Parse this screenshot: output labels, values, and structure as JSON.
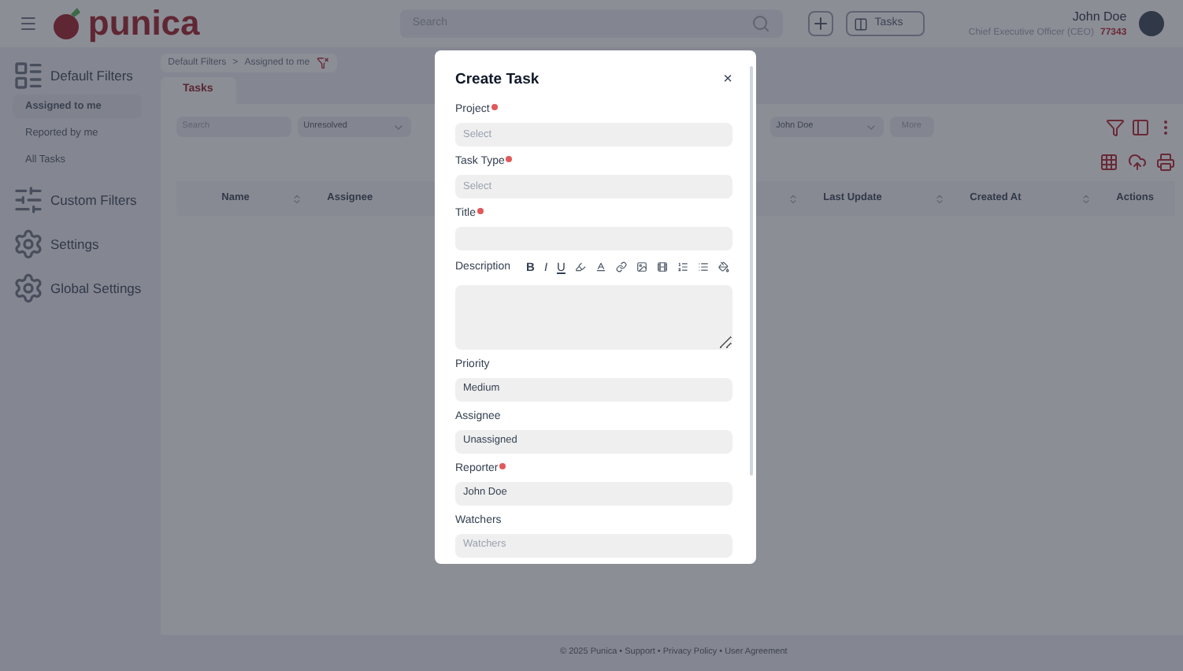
{
  "header": {
    "logo_text": "punica",
    "search": {
      "placeholder": "Search"
    },
    "tasks_button": "Tasks",
    "user": {
      "name": "John Doe",
      "role": "Chief Executive Officer (CEO)",
      "id": "77343"
    }
  },
  "sidebar": {
    "sections": [
      {
        "kind": "group",
        "label": "Default Filters",
        "items": [
          {
            "label": "Assigned to me",
            "selected": true
          },
          {
            "label": "Reported by me",
            "selected": false
          },
          {
            "label": "All Tasks",
            "selected": false
          }
        ]
      },
      {
        "kind": "sliders",
        "label": "Custom Filters"
      },
      {
        "kind": "gear",
        "label": "Settings"
      },
      {
        "kind": "gear",
        "label": "Global Settings"
      }
    ]
  },
  "breadcrumb": [
    "Default Filters",
    ">",
    "Assigned to me"
  ],
  "tabs": [
    {
      "label": "Tasks",
      "selected": true
    }
  ],
  "filters": {
    "search": {
      "placeholder": "Search"
    },
    "chips": [
      {
        "label": "Unresolved"
      },
      {
        "label": "John Doe"
      }
    ],
    "more": "More"
  },
  "table": {
    "columns": [
      {
        "label": "Name"
      },
      {
        "label": "Assignee"
      },
      {
        "label": "Last Update"
      },
      {
        "label": "Created At"
      },
      {
        "label": "Actions"
      }
    ]
  },
  "footer": "© 2025 Punica • Support • Privacy Policy • User Agreement",
  "modal": {
    "title": "Create Task",
    "close": "×",
    "fields": [
      {
        "kind": "select",
        "label": "Project",
        "required": true,
        "placeholder": "Select"
      },
      {
        "kind": "select",
        "label": "Task Type",
        "required": true,
        "placeholder": "Select"
      },
      {
        "kind": "text",
        "label": "Title",
        "required": true
      },
      {
        "kind": "editor",
        "label": "Description",
        "required": false,
        "format_buttons": [
          "B",
          "I",
          "U"
        ]
      },
      {
        "kind": "select",
        "label": "Priority",
        "required": false,
        "value": "Medium"
      },
      {
        "kind": "select",
        "label": "Assignee",
        "required": false,
        "value": "Unassigned"
      },
      {
        "kind": "select",
        "label": "Reporter",
        "required": true,
        "value": "John Doe"
      },
      {
        "kind": "select",
        "label": "Watchers",
        "required": false,
        "placeholder": "Watchers"
      }
    ]
  }
}
